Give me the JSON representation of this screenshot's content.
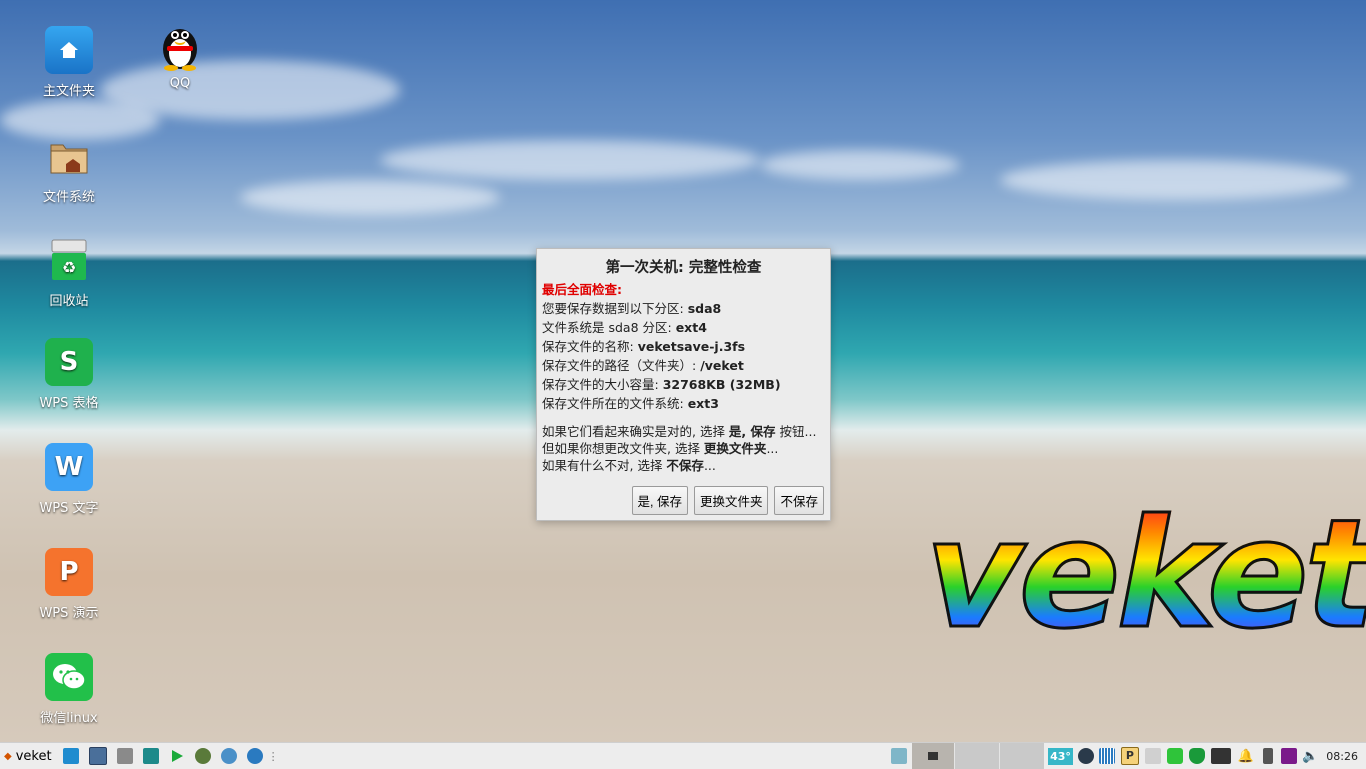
{
  "desktop_icons": [
    {
      "name": "home-folder",
      "label": "主文件夹"
    },
    {
      "name": "qq",
      "label": "QQ"
    },
    {
      "name": "file-system",
      "label": "文件系统"
    },
    {
      "name": "recycle-bin",
      "label": "回收站"
    },
    {
      "name": "wps-sheets",
      "label": "WPS 表格"
    },
    {
      "name": "wps-writer",
      "label": "WPS 文字"
    },
    {
      "name": "wps-presentation",
      "label": "WPS 演示"
    },
    {
      "name": "wechat",
      "label": "微信linux"
    }
  ],
  "logo_text": "veket",
  "dialog": {
    "title": "第一次关机: 完整性检查",
    "heading": "最后全面检查:",
    "lines": [
      {
        "label": "您要保存数据到以下分区: ",
        "value": "sda8"
      },
      {
        "label": "文件系统是 sda8 分区: ",
        "value": "ext4"
      },
      {
        "label": "保存文件的名称: ",
        "value": "veketsave-j.3fs"
      },
      {
        "label": "保存文件的路径（文件夹）: ",
        "value": "/veket"
      },
      {
        "label": "保存文件的大小容量: ",
        "value": "32768KB (32MB)"
      },
      {
        "label": "保存文件所在的文件系统: ",
        "value": "ext3"
      }
    ],
    "msg1_pre": "如果它们看起来确实是对的, 选择 ",
    "msg1_bold": "是, 保存",
    "msg1_post": " 按钮...",
    "msg2_pre": "但如果你想更改文件夹, 选择 ",
    "msg2_bold": "更换文件夹",
    "msg2_post": "...",
    "msg3_pre": "如果有什么不对, 选择 ",
    "msg3_bold": "不保存",
    "msg3_post": "...",
    "buttons": {
      "yes": "是, 保存",
      "change": "更换文件夹",
      "no": "不保存"
    }
  },
  "taskbar": {
    "start_label": "veket",
    "temperature": "43°",
    "clock": "08:26"
  }
}
